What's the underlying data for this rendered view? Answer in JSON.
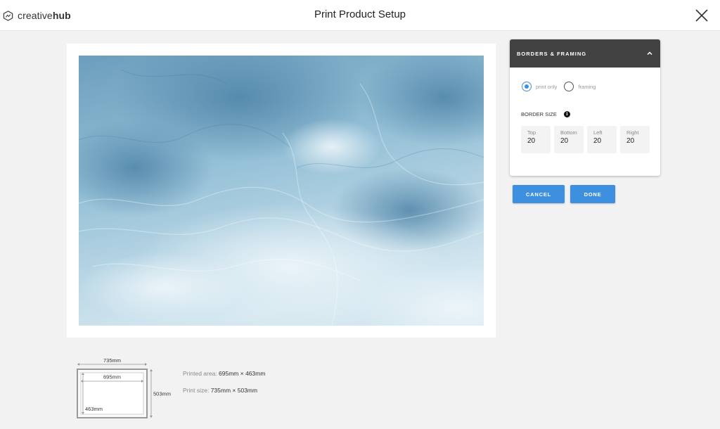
{
  "header": {
    "brand_regular": "creative",
    "brand_bold": "hub",
    "title": "Print Product Setup"
  },
  "panel": {
    "title": "BORDERS & FRAMING",
    "radio_options": [
      "print only",
      "framing"
    ],
    "selected_option": "print only",
    "border_size_label": "BORDER SIZE",
    "info_glyph": "i",
    "fields": [
      {
        "label": "Top",
        "value": "20"
      },
      {
        "label": "Bottom",
        "value": "20"
      },
      {
        "label": "Left",
        "value": "20"
      },
      {
        "label": "Right",
        "value": "20"
      }
    ]
  },
  "buttons": {
    "cancel": "CANCEL",
    "done": "DONE"
  },
  "diagram": {
    "outer_width": "735mm",
    "inner_width": "695mm",
    "outer_height": "503mm",
    "inner_height": "463mm"
  },
  "info": {
    "printed_area_label": "Printed area:",
    "printed_area_value": "695mm × 463mm",
    "print_size_label": "Print size:",
    "print_size_value": "735mm × 503mm"
  },
  "colors": {
    "accent": "#3d8fe0",
    "panel_header": "#424242",
    "background": "#f2f2f2"
  }
}
